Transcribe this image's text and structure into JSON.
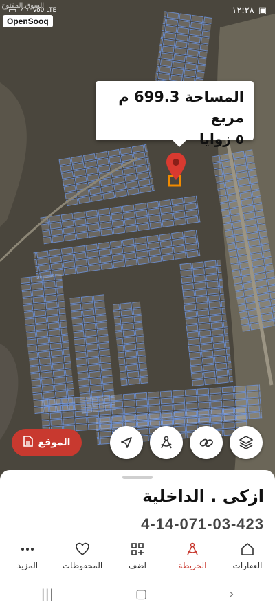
{
  "status_bar": {
    "time": "١٢:٢٨",
    "network": "Vo0 LTE",
    "watermark": "السوق المفتوح"
  },
  "brand": "OpenSooq",
  "popup": {
    "area_line": "المساحة 699.3 م مربع",
    "angles_line": "٥ زوايا"
  },
  "location_button": {
    "label": "الموقع"
  },
  "parcel": {
    "title": "ازكى . الداخلية",
    "code": "4-14-071-03-423"
  },
  "bottom_nav": [
    {
      "label": "العقارات",
      "icon": "home-icon"
    },
    {
      "label": "الخريطة",
      "icon": "map-compass-icon",
      "active": true
    },
    {
      "label": "اضف",
      "icon": "add-grid-icon"
    },
    {
      "label": "المحفوظات",
      "icon": "heart-icon"
    },
    {
      "label": "المزيد",
      "icon": "more-dots-icon"
    }
  ],
  "colors": {
    "accent": "#c8392f",
    "parcel_outline": "#4a7fd6",
    "highlight_parcel": "#f08a00"
  }
}
